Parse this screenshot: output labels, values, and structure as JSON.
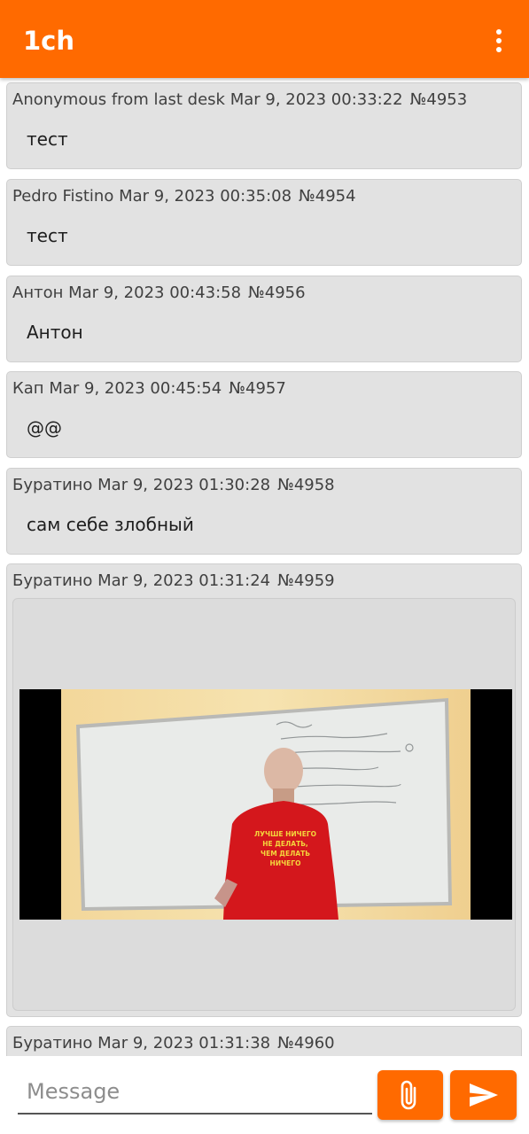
{
  "app": {
    "title": "1ch"
  },
  "colors": {
    "accent": "#ff6a00",
    "post_background": "#e2e2e2"
  },
  "icons": {
    "menu": "more-vert-icon",
    "attach": "paperclip-icon",
    "send": "send-icon"
  },
  "posts": [
    {
      "author": "Anonymous from last desk",
      "date": "Mar 9, 2023 00:33:22",
      "number": "№4953",
      "text": "тест"
    },
    {
      "author": "Pedro Fistino",
      "date": "Mar 9, 2023 00:35:08",
      "number": "№4954",
      "text": "тест"
    },
    {
      "author": "Антон",
      "date": "Mar 9, 2023 00:43:58",
      "number": "№4956",
      "text": "Антон"
    },
    {
      "author": "Кап",
      "date": "Mar 9, 2023 00:45:54",
      "number": "№4957",
      "text": "@@"
    },
    {
      "author": "Буратино",
      "date": "Mar 9, 2023 01:30:28",
      "number": "№4958",
      "text": "сам себе злобный"
    },
    {
      "author": "Буратино",
      "date": "Mar 9, 2023 01:31:24",
      "number": "№4959",
      "text": "",
      "media": {
        "type": "video",
        "shirt_text": [
          "ЛУЧШЕ НИЧЕГО",
          "НЕ ДЕЛАТЬ,",
          "ЧЕМ ДЕЛАТЬ",
          "НИЧЕГО"
        ]
      }
    },
    {
      "author": "Буратино",
      "date": "Mar 9, 2023 01:31:38",
      "number": "№4960",
      "text": ""
    }
  ],
  "composer": {
    "placeholder": "Message",
    "value": ""
  }
}
